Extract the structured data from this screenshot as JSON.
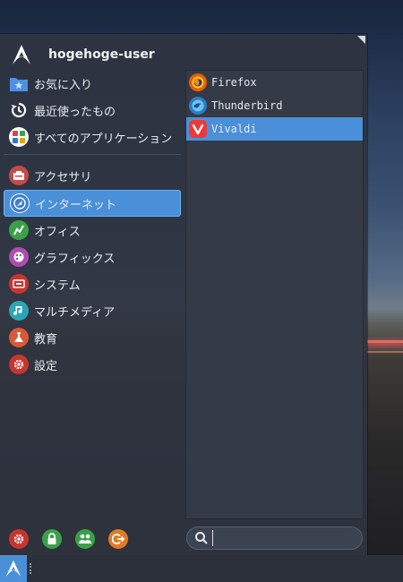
{
  "header": {
    "username": "hogehoge-user"
  },
  "categories": [
    {
      "label": "お気に入り",
      "icon": "folder-star-icon",
      "color": "#4f8fe0"
    },
    {
      "label": "最近使ったもの",
      "icon": "history-icon",
      "color": "#ffffff"
    },
    {
      "label": "すべてのアプリケーション",
      "icon": "all-apps-icon",
      "color": "#d9464a"
    }
  ],
  "categories2": [
    {
      "label": "アクセサリ",
      "icon": "accessories-icon",
      "color": "#c54a4a"
    },
    {
      "label": "インターネット",
      "icon": "internet-icon",
      "color": "#3f7fcf",
      "selected": true
    },
    {
      "label": "オフィス",
      "icon": "office-icon",
      "color": "#3aa14a"
    },
    {
      "label": "グラフィックス",
      "icon": "graphics-icon",
      "color": "#b04bb0"
    },
    {
      "label": "システム",
      "icon": "system-icon",
      "color": "#c8352f"
    },
    {
      "label": "マルチメディア",
      "icon": "multimedia-icon",
      "color": "#2aa6b8"
    },
    {
      "label": "教育",
      "icon": "education-icon",
      "color": "#d9583a"
    },
    {
      "label": "設定",
      "icon": "settings-icon",
      "color": "#c8352f"
    }
  ],
  "apps": [
    {
      "label": "Firefox",
      "icon": "firefox-icon",
      "color": "#e66000"
    },
    {
      "label": "Thunderbird",
      "icon": "thunderbird-icon",
      "color": "#2a7cc7"
    },
    {
      "label": "Vivaldi",
      "icon": "vivaldi-icon",
      "color": "#ef3939",
      "selected": true
    }
  ],
  "search": {
    "placeholder": "",
    "value": ""
  },
  "actions": [
    {
      "name": "settings-action-icon",
      "color": "#c8352f"
    },
    {
      "name": "lock-action-icon",
      "color": "#3aa14a"
    },
    {
      "name": "switch-user-action-icon",
      "color": "#3aa14a"
    },
    {
      "name": "logout-action-icon",
      "color": "#e07b24"
    }
  ],
  "colors": {
    "accent": "#4a90d9",
    "panel": "#2e3440",
    "apps_bg": "#343a46"
  }
}
